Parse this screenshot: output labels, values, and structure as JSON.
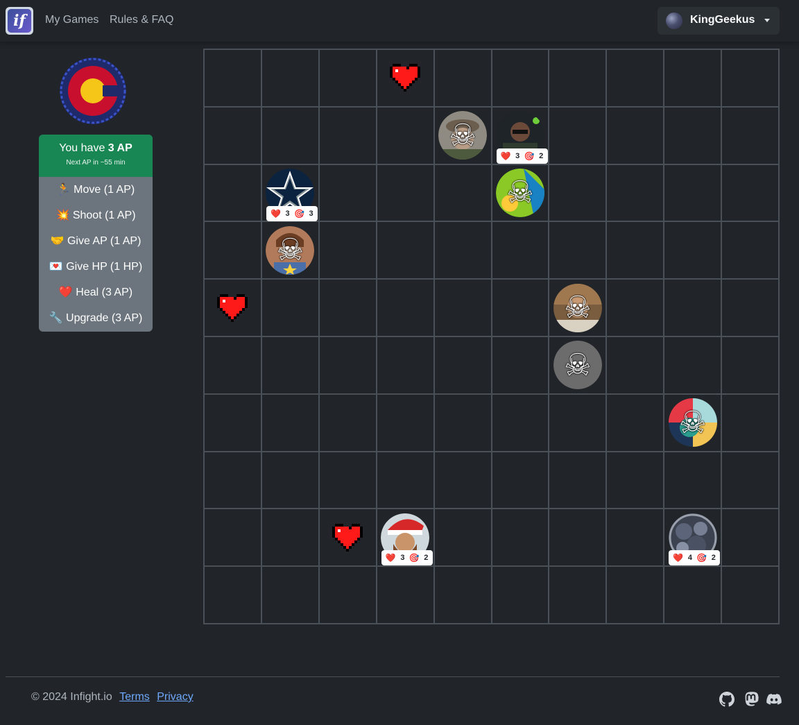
{
  "nav": {
    "brand_text": "if",
    "links": [
      "My Games",
      "Rules & FAQ"
    ],
    "user": {
      "name": "KingGeekus"
    }
  },
  "sidebar": {
    "ap": {
      "prefix": "You have ",
      "value": "3 AP",
      "next": "Next AP in ~55 min"
    },
    "actions": [
      {
        "icon": "🏃",
        "label": "Move (1 AP)"
      },
      {
        "icon": "💥",
        "label": "Shoot (1 AP)"
      },
      {
        "icon": "🤝",
        "label": "Give AP (1 AP)"
      },
      {
        "icon": "💌",
        "label": "Give HP (1 HP)"
      },
      {
        "icon": "❤️",
        "label": "Heal (3 AP)"
      },
      {
        "icon": "🔧",
        "label": "Upgrade (3 AP)"
      }
    ]
  },
  "board": {
    "size": 10,
    "hearts": [
      {
        "row": 0,
        "col": 3
      },
      {
        "row": 4,
        "col": 0
      },
      {
        "row": 8,
        "col": 2
      }
    ],
    "players": [
      {
        "row": 1,
        "col": 4,
        "dead": true,
        "avatar": "gray-hat"
      },
      {
        "row": 1,
        "col": 5,
        "dead": false,
        "hp": "3",
        "range": "2",
        "avatar": "dark-photo"
      },
      {
        "row": 2,
        "col": 1,
        "dead": false,
        "hp": "3",
        "range": "3",
        "avatar": "star"
      },
      {
        "row": 2,
        "col": 5,
        "dead": true,
        "avatar": "green"
      },
      {
        "row": 3,
        "col": 1,
        "dead": true,
        "avatar": "brown"
      },
      {
        "row": 4,
        "col": 6,
        "dead": true,
        "avatar": "tan"
      },
      {
        "row": 5,
        "col": 6,
        "dead": true,
        "avatar": "plain"
      },
      {
        "row": 6,
        "col": 8,
        "dead": true,
        "avatar": "colorful"
      },
      {
        "row": 8,
        "col": 3,
        "dead": false,
        "hp": "3",
        "range": "2",
        "avatar": "santa"
      },
      {
        "row": 8,
        "col": 8,
        "dead": false,
        "hp": "4",
        "range": "2",
        "avatar": "bluegray"
      }
    ],
    "skull_glyph": "☠",
    "heart_glyph": "❤️",
    "target_glyph": "🎯"
  },
  "footer": {
    "copyright": "© 2024 Infight.io",
    "links": [
      "Terms",
      "Privacy"
    ],
    "social": [
      "github-icon",
      "mastodon-icon",
      "discord-icon"
    ]
  },
  "colors": {
    "background": "#212529",
    "ap_green": "#198754",
    "action_gray": "#6c757d",
    "link_blue": "#6ea8fe"
  }
}
